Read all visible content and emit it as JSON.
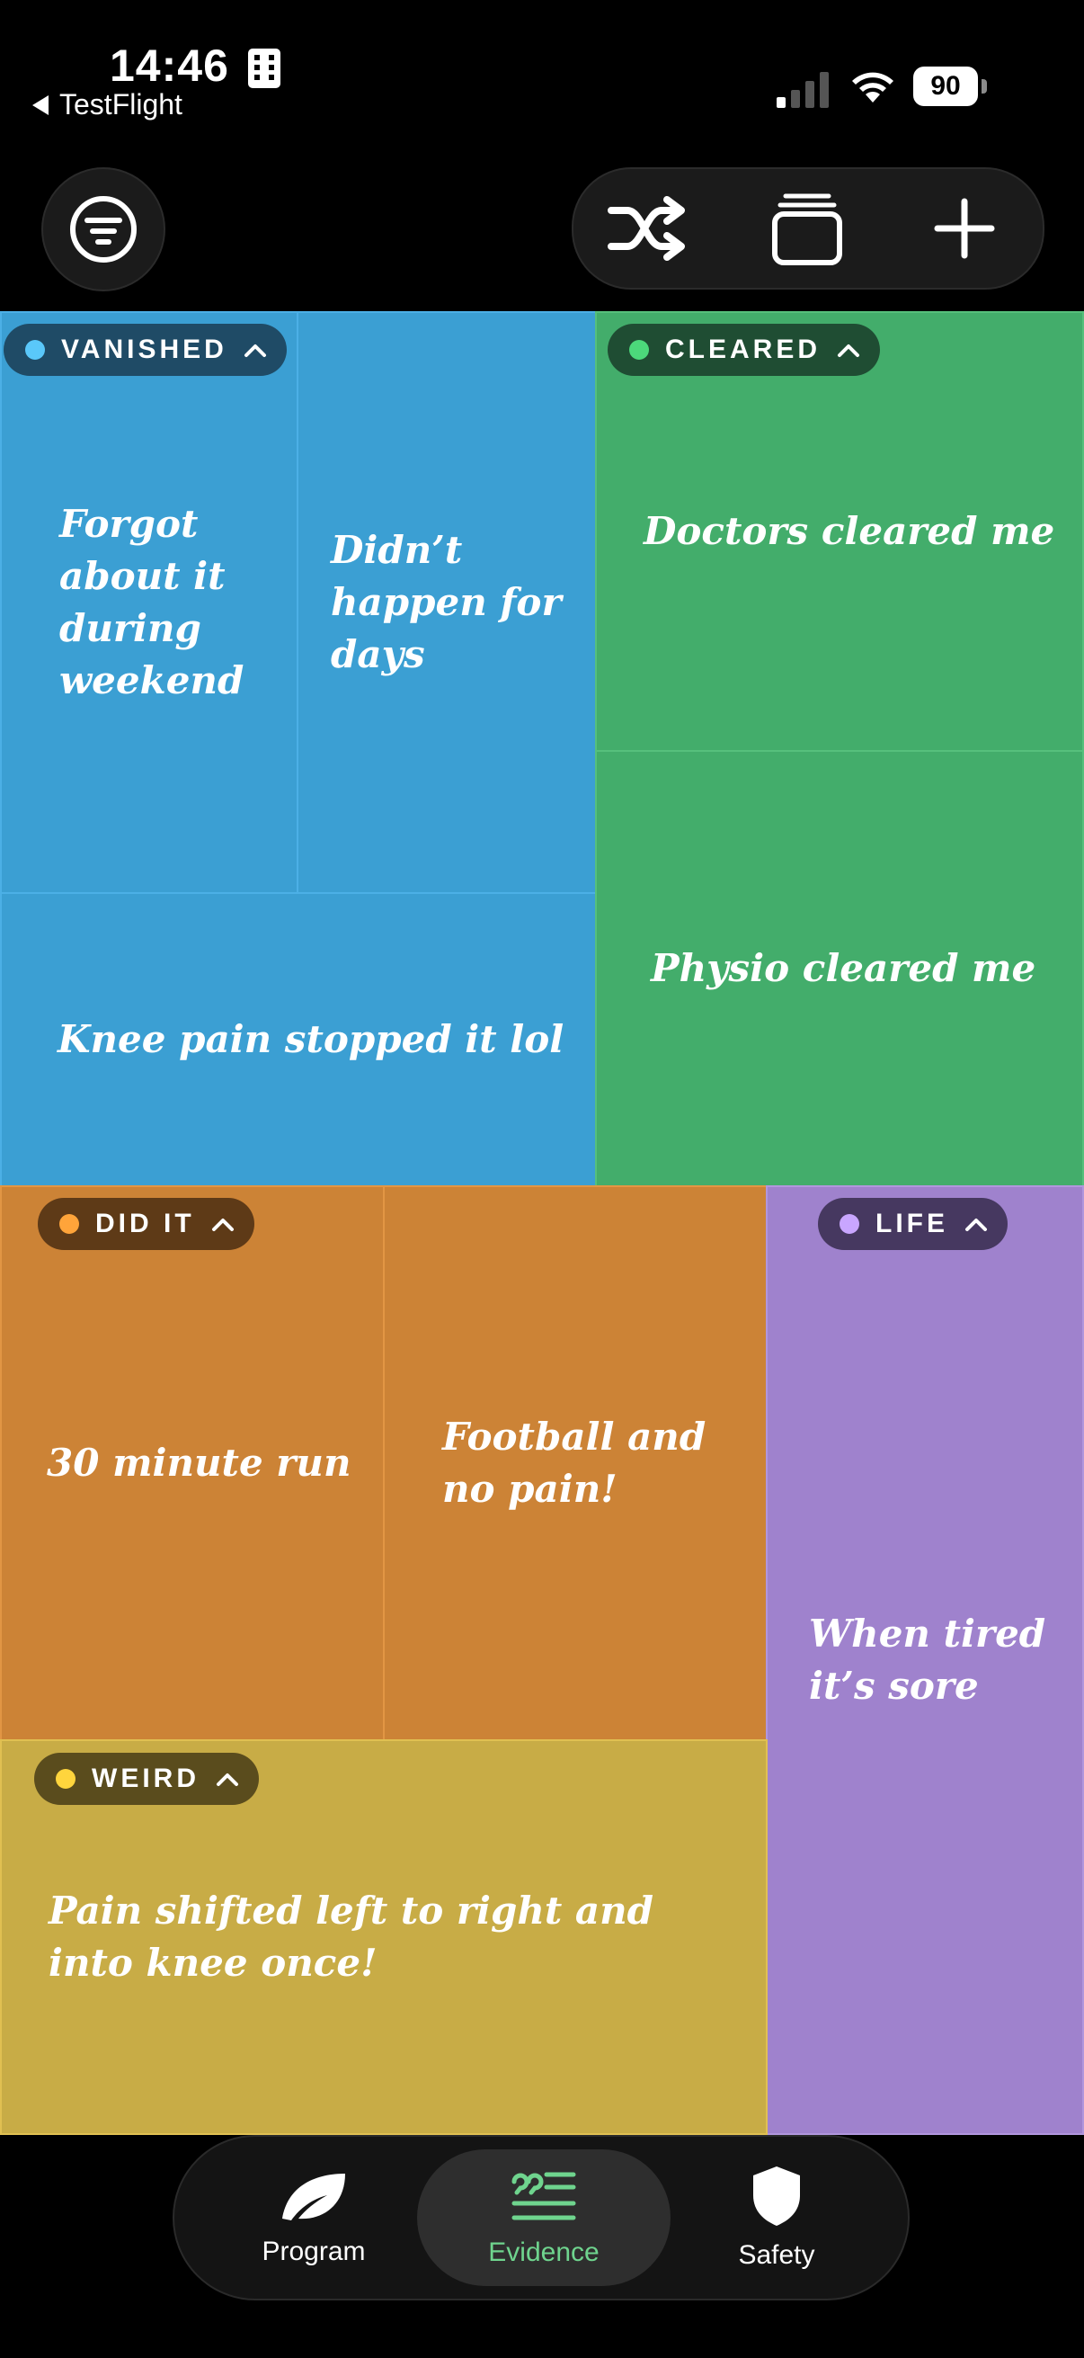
{
  "status_bar": {
    "time": "14:46",
    "back_label": "TestFlight",
    "battery": "90"
  },
  "toolbar": {
    "icons": [
      "filter-icon",
      "shuffle-icon",
      "stack-icon",
      "plus-icon"
    ]
  },
  "groups": [
    {
      "label": "VANISHED",
      "dot_color": "#5ac8fa",
      "tile_color": "#3b9fd3",
      "items": [
        "Forgot about it during weekend",
        "Didn’t happen for days",
        "Knee pain stopped it lol"
      ]
    },
    {
      "label": "CLEARED",
      "dot_color": "#4cd97b",
      "tile_color": "#43ad6b",
      "items": [
        "Doctors cleared me",
        "Physio cleared me"
      ]
    },
    {
      "label": "DID IT",
      "dot_color": "#ffa43a",
      "tile_color": "#cc8336",
      "items": [
        "30 minute run",
        "Football and no pain!"
      ]
    },
    {
      "label": "LIFE",
      "dot_color": "#c9a6ff",
      "tile_color": "#9f82cd",
      "items": [
        "When tired it’s sore"
      ]
    },
    {
      "label": "WEIRD",
      "dot_color": "#ffd53d",
      "tile_color": "#c8ac46",
      "items": [
        "Pain shifted left to right and into knee once!"
      ]
    }
  ],
  "tabs": [
    {
      "label": "Program",
      "icon": "leaf-icon",
      "active": false
    },
    {
      "label": "Evidence",
      "icon": "quote-list-icon",
      "active": true
    },
    {
      "label": "Safety",
      "icon": "shield-icon",
      "active": false
    }
  ],
  "colors": {
    "accent": "#6fd48e",
    "background": "#000000"
  }
}
